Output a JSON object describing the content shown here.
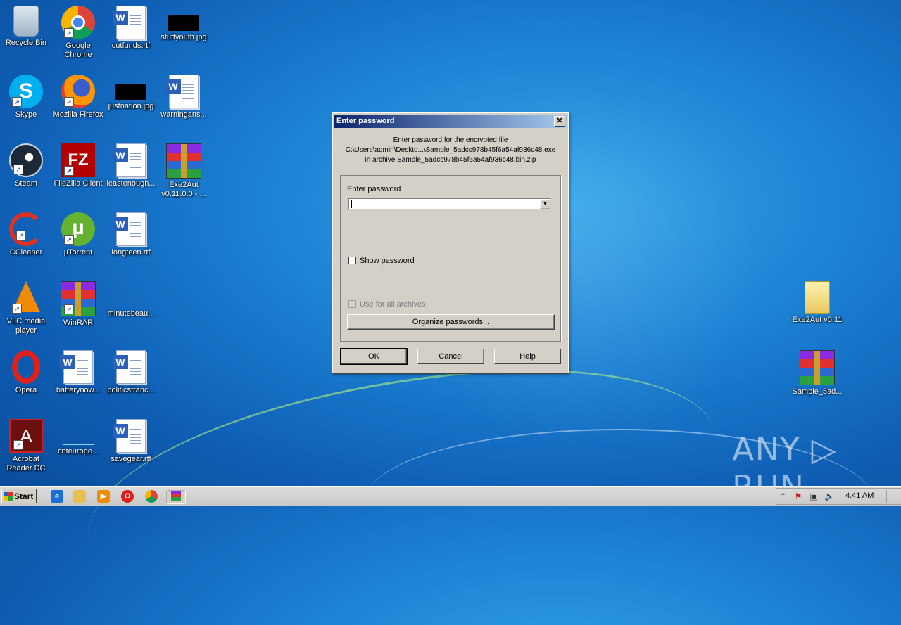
{
  "desktop": {
    "icons": [
      {
        "label": "Recycle Bin"
      },
      {
        "label": "Google Chrome"
      },
      {
        "label": "cutfunds.rtf"
      },
      {
        "label": "stuffyouth.jpg"
      },
      {
        "label": "Skype"
      },
      {
        "label": "Mozilla Firefox"
      },
      {
        "label": "justnation.jpg"
      },
      {
        "label": "warningans..."
      },
      {
        "label": "Steam"
      },
      {
        "label": "FileZilla Client"
      },
      {
        "label": "leastenough..."
      },
      {
        "label": "Exe2Aut v0.11.0.0 - ..."
      },
      {
        "label": "CCleaner"
      },
      {
        "label": "µTorrent"
      },
      {
        "label": "longteen.rtf"
      },
      {
        "label": "VLC media player"
      },
      {
        "label": "WinRAR"
      },
      {
        "label": "minutebeau..."
      },
      {
        "label": "Opera"
      },
      {
        "label": "batterynow..."
      },
      {
        "label": "politicsfranc..."
      },
      {
        "label": "Acrobat Reader DC"
      },
      {
        "label": "cnteurope..."
      },
      {
        "label": "savegear.rtf"
      },
      {
        "label": "Exe2Aut v0.11"
      },
      {
        "label": "Sample_5ad..."
      }
    ]
  },
  "dialog": {
    "title": "Enter password",
    "close_label": "✕",
    "info_line1": "Enter password for the encrypted file",
    "info_line2": "C:\\Users\\admin\\Deskto...\\Sample_5adcc978b45f6a54af936c48.exe",
    "info_line3": "in archive Sample_5adcc978b45f6a54af936c48.bin.zip",
    "password_label": "Enter password",
    "password_value": "",
    "show_password_label": "Show password",
    "use_all_label": "Use for all archives",
    "organize_label": "Organize passwords...",
    "ok_label": "OK",
    "cancel_label": "Cancel",
    "help_label": "Help"
  },
  "taskbar": {
    "start_label": "Start",
    "clock": "4:41 AM"
  },
  "watermark": "ANY ▷ RUN"
}
